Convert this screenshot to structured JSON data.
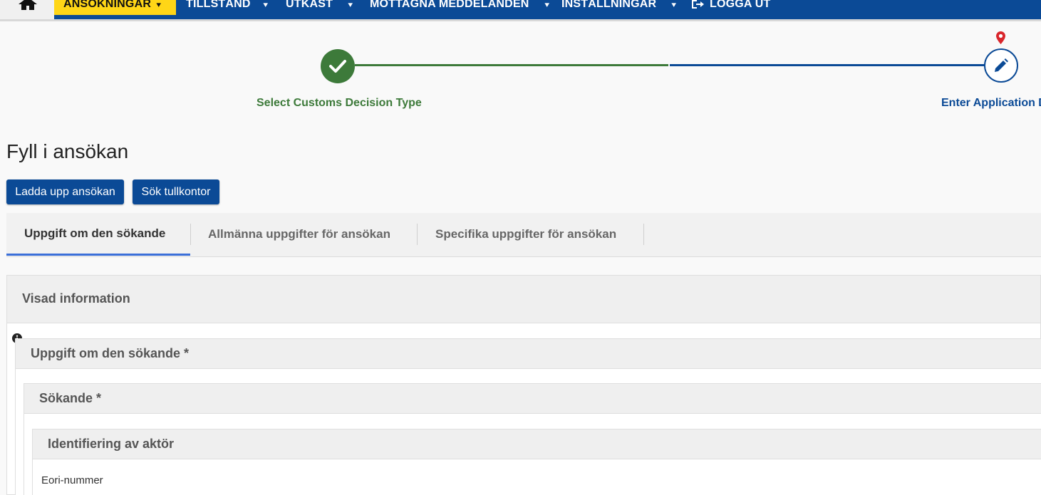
{
  "nav": {
    "items": [
      {
        "label": "ANSÖKNINGAR"
      },
      {
        "label": "TILLSTÅND"
      },
      {
        "label": "UTKAST"
      },
      {
        "label": "MOTTAGNA MEDDELANDEN"
      },
      {
        "label": "INSTÄLLNINGAR"
      }
    ],
    "logout_label": "LOGGA UT"
  },
  "stepper": {
    "steps": [
      {
        "label": "Select Customs Decision Type",
        "status": "done"
      },
      {
        "label": "Enter Application D",
        "status": "current"
      }
    ],
    "colors": {
      "done": "#3d7a3a",
      "current": "#0b4a96",
      "marker": "#d9262c"
    }
  },
  "page": {
    "title": "Fyll i ansökan"
  },
  "buttons": {
    "upload": "Ladda upp ansökan",
    "search_office": "Sök tullkontor"
  },
  "tabs": [
    {
      "label": "Uppgift om den sökande",
      "active": true
    },
    {
      "label": "Allmänna uppgifter för ansökan",
      "active": false
    },
    {
      "label": "Specifika uppgifter för ansökan",
      "active": false
    }
  ],
  "panel": {
    "title": "Visad information",
    "section": {
      "title": "Uppgift om den sökande *",
      "subsection": {
        "title": "Sökande *",
        "group": {
          "title": "Identifiering av aktör",
          "field_label": "Eori-nummer"
        }
      }
    }
  }
}
